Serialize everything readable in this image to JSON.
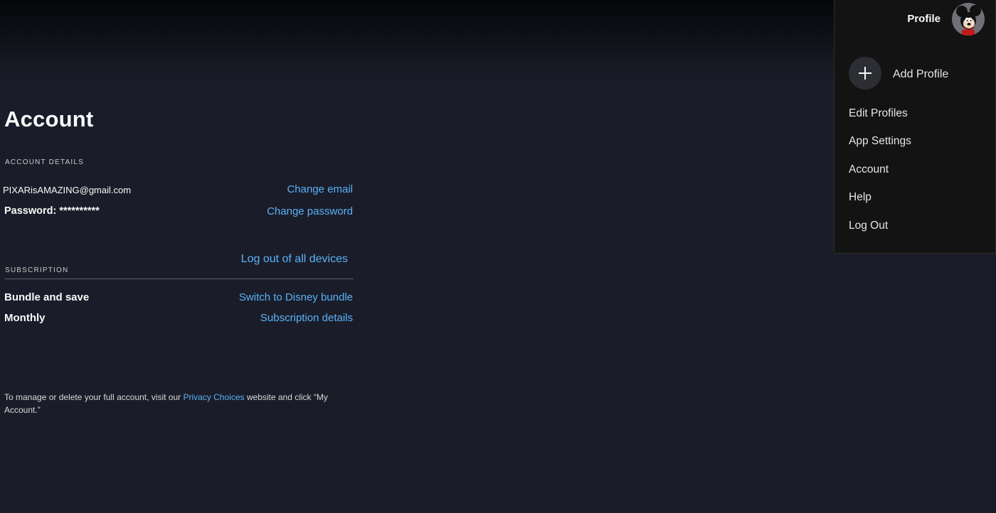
{
  "account": {
    "title": "Account",
    "details_label": "ACCOUNT DETAILS",
    "email": "PIXARisAMAZING@gmail.com",
    "change_email": "Change email",
    "password_label": "Password:",
    "password_mask": "**********",
    "change_password": "Change password",
    "logout_all": "Log out of all devices"
  },
  "subscription": {
    "label": "SUBSCRIPTION",
    "plan": "Bundle and save",
    "switch_link": "Switch to Disney bundle",
    "billing": "Monthly",
    "details_link": "Subscription details"
  },
  "footnote": {
    "before": "To manage or delete your full account, visit our ",
    "link": "Privacy Choices",
    "after": " website and click “My Account.”"
  },
  "profile_menu": {
    "profile_name": "Profile",
    "avatar_icon": "mickey-avatar",
    "add_profile": "Add Profile",
    "items": [
      "Edit Profiles",
      "App Settings",
      "Account",
      "Help",
      "Log Out"
    ]
  },
  "colors": {
    "background": "#1a1d29",
    "link": "#5ab2f7",
    "menu_background": "#131313"
  }
}
